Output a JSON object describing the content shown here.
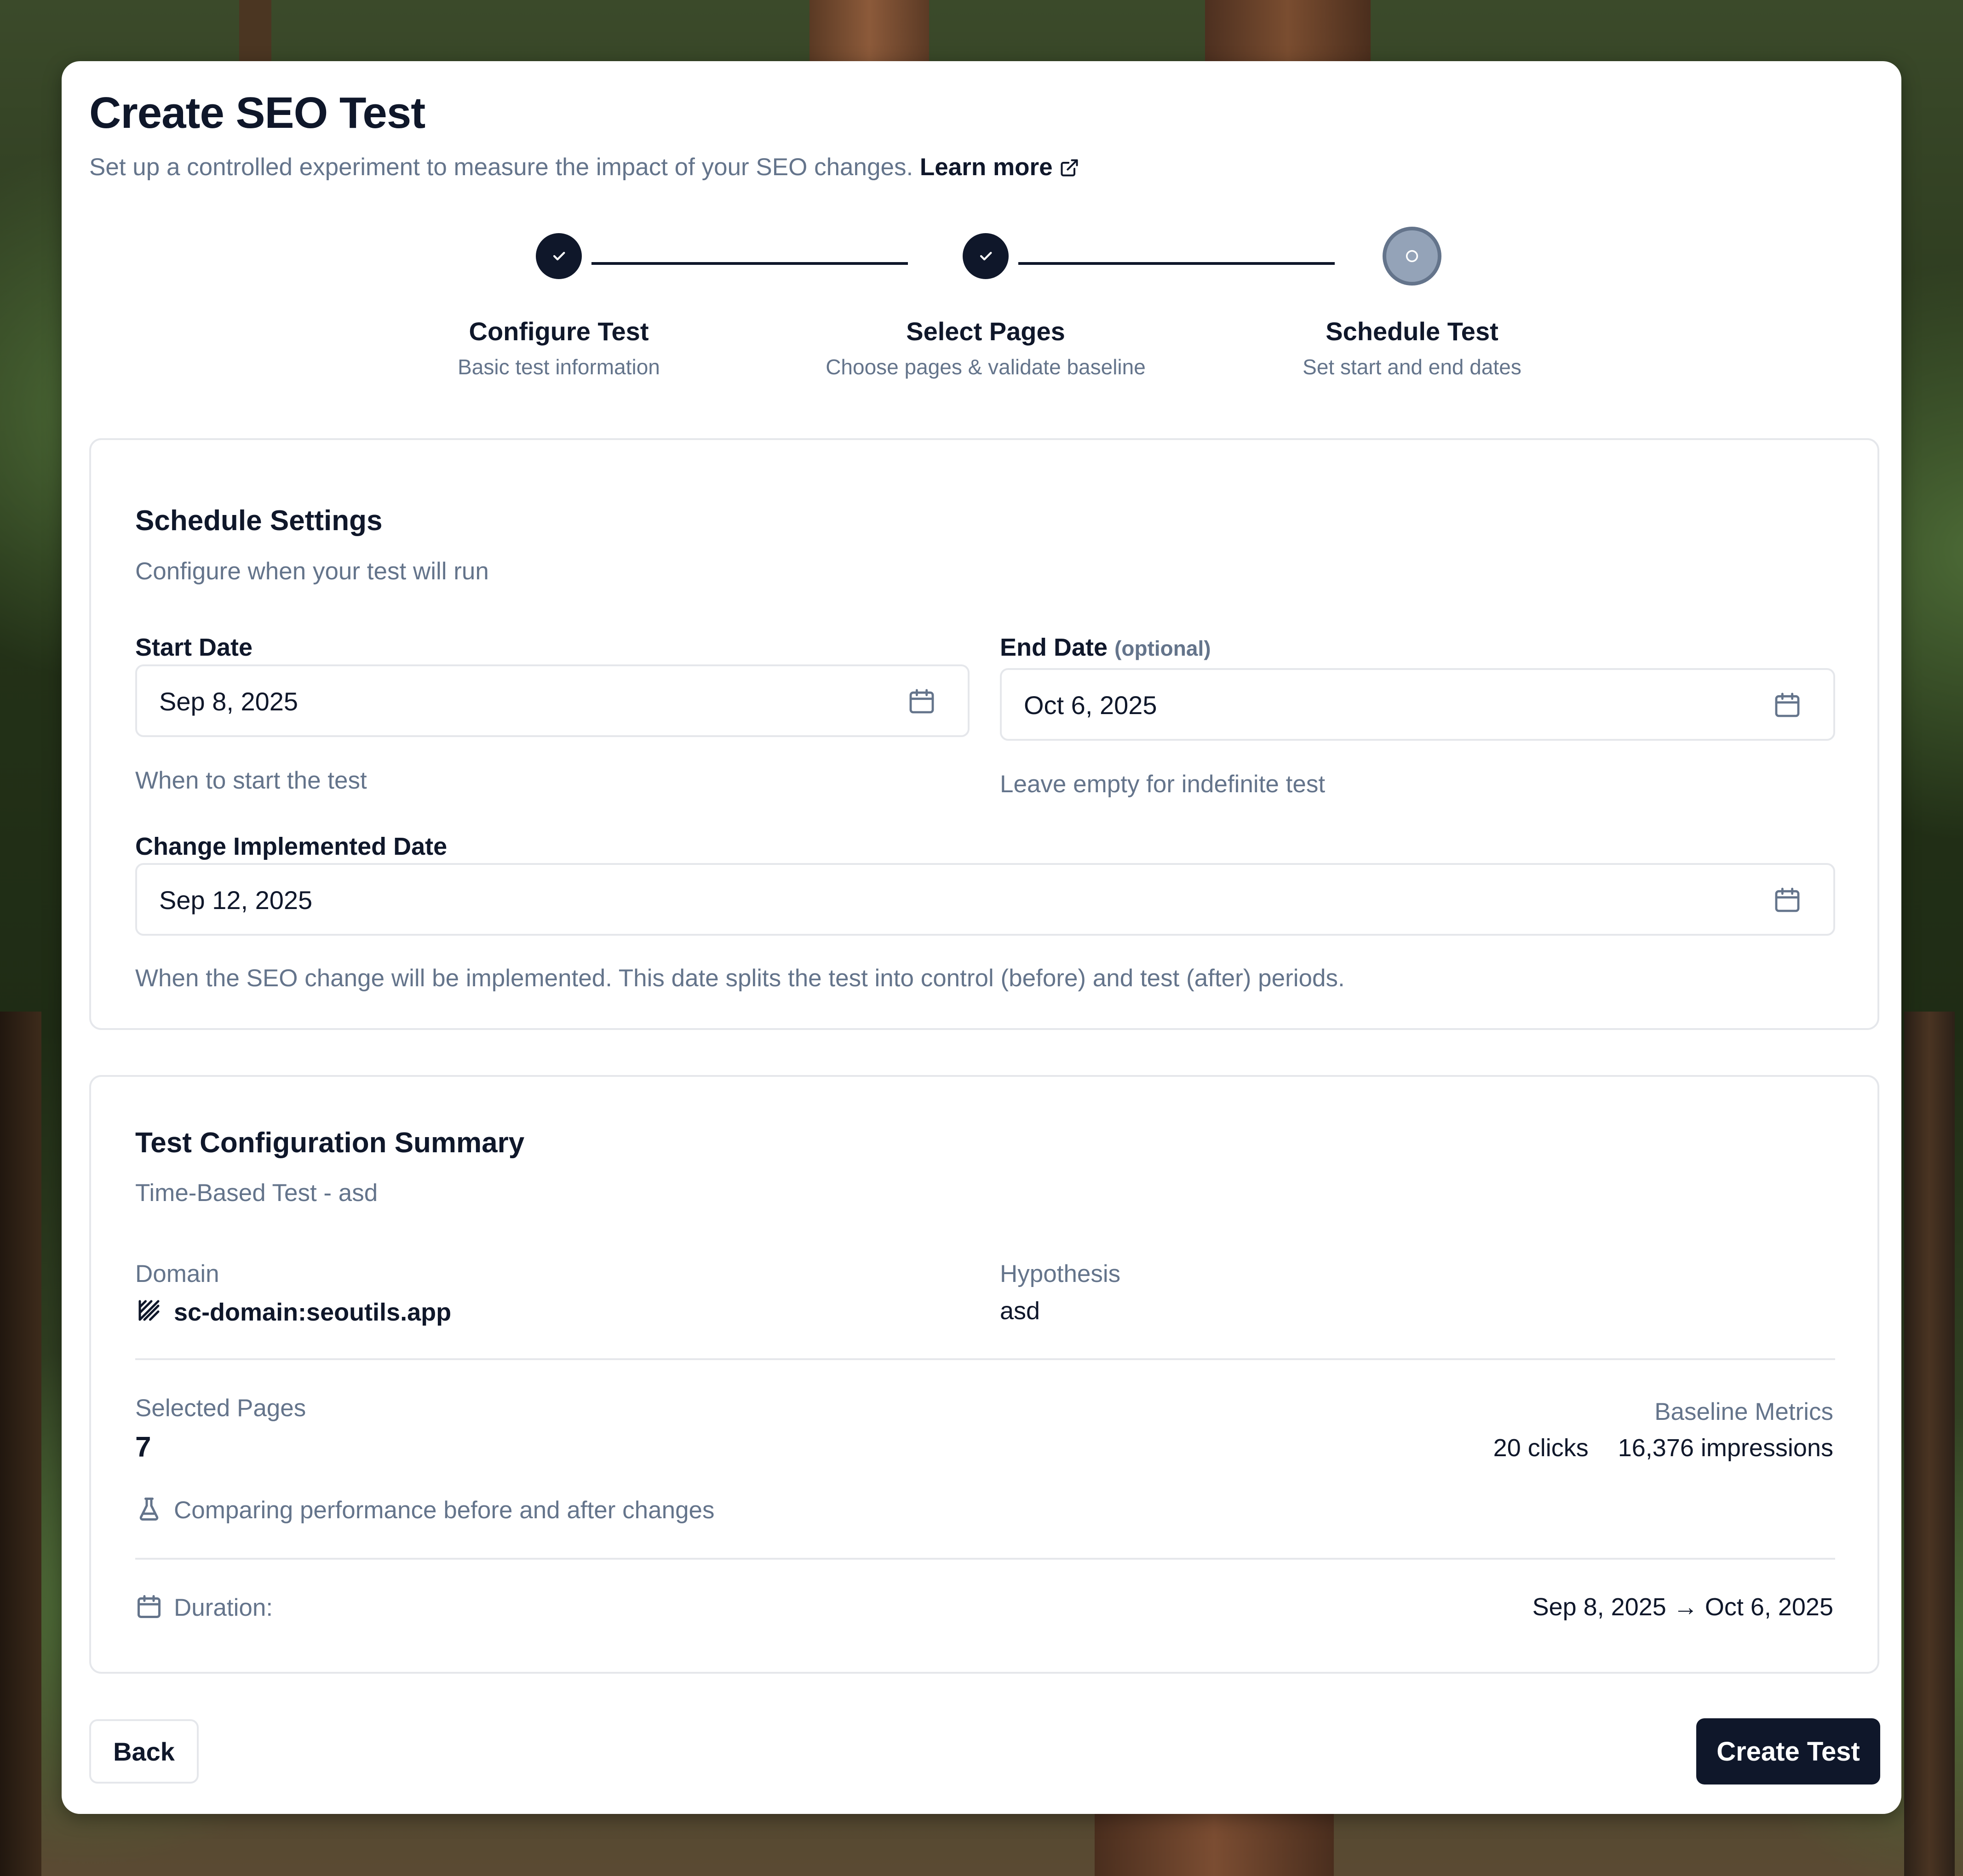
{
  "header": {
    "title": "Create SEO Test",
    "subtitle": "Set up a controlled experiment to measure the impact of your SEO changes.",
    "learn_more": "Learn more"
  },
  "steps": [
    {
      "title": "Configure Test",
      "desc": "Basic test information",
      "state": "complete"
    },
    {
      "title": "Select Pages",
      "desc": "Choose pages & validate baseline",
      "state": "complete"
    },
    {
      "title": "Schedule Test",
      "desc": "Set start and end dates",
      "state": "current"
    }
  ],
  "schedule": {
    "title": "Schedule Settings",
    "desc": "Configure when your test will run",
    "start_label": "Start Date",
    "start_value": "Sep 8, 2025",
    "start_help": "When to start the test",
    "end_label": "End Date",
    "end_optional": "(optional)",
    "end_value": "Oct 6, 2025",
    "end_help": "Leave empty for indefinite test",
    "change_label": "Change Implemented Date",
    "change_value": "Sep 12, 2025",
    "change_help": "When the SEO change will be implemented. This date splits the test into control (before) and test (after) periods."
  },
  "summary": {
    "title": "Test Configuration Summary",
    "subtitle": "Time-Based Test - asd",
    "domain_label": "Domain",
    "domain_value": "sc-domain:seoutils.app",
    "hypothesis_label": "Hypothesis",
    "hypothesis_value": "asd",
    "pages_label": "Selected Pages",
    "pages_value": "7",
    "baseline_label": "Baseline Metrics",
    "clicks": "20 clicks",
    "impressions": "16,376 impressions",
    "comparing": "Comparing performance before and after changes",
    "duration_label": "Duration:",
    "duration_value": "Sep 8, 2025 → Oct 6, 2025"
  },
  "buttons": {
    "back": "Back",
    "create": "Create Test"
  },
  "colors": {
    "primary": "#0f172a",
    "muted": "#64748b",
    "border": "#e5e7eb",
    "step_current": "#94a3b8"
  }
}
